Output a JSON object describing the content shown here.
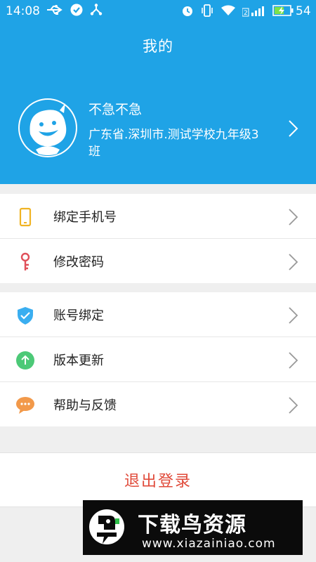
{
  "status_bar": {
    "time": "14:08",
    "battery": "54",
    "sim_indicator": "2"
  },
  "header": {
    "title": "我的",
    "username": "不急不急",
    "school": "广东省.深圳市.测试学校九年级3班"
  },
  "menu_groups": [
    [
      {
        "label": "绑定手机号",
        "icon": "phone-icon",
        "color": "#f0b323"
      },
      {
        "label": "修改密码",
        "icon": "key-icon",
        "color": "#e0505a"
      }
    ],
    [
      {
        "label": "账号绑定",
        "icon": "shield-check-icon",
        "color": "#3aaef0"
      },
      {
        "label": "版本更新",
        "icon": "upgrade-arrow-icon",
        "color": "#4cc977"
      },
      {
        "label": "帮助与反馈",
        "icon": "chat-bubble-icon",
        "color": "#f2994a"
      }
    ]
  ],
  "logout": {
    "label": "退出登录",
    "color": "#e04a3a"
  },
  "watermark": {
    "title": "下载鸟资源",
    "url": "www.xiazainiao.com"
  },
  "colors": {
    "header_bg": "#1fa3e6",
    "page_bg": "#efefef"
  }
}
